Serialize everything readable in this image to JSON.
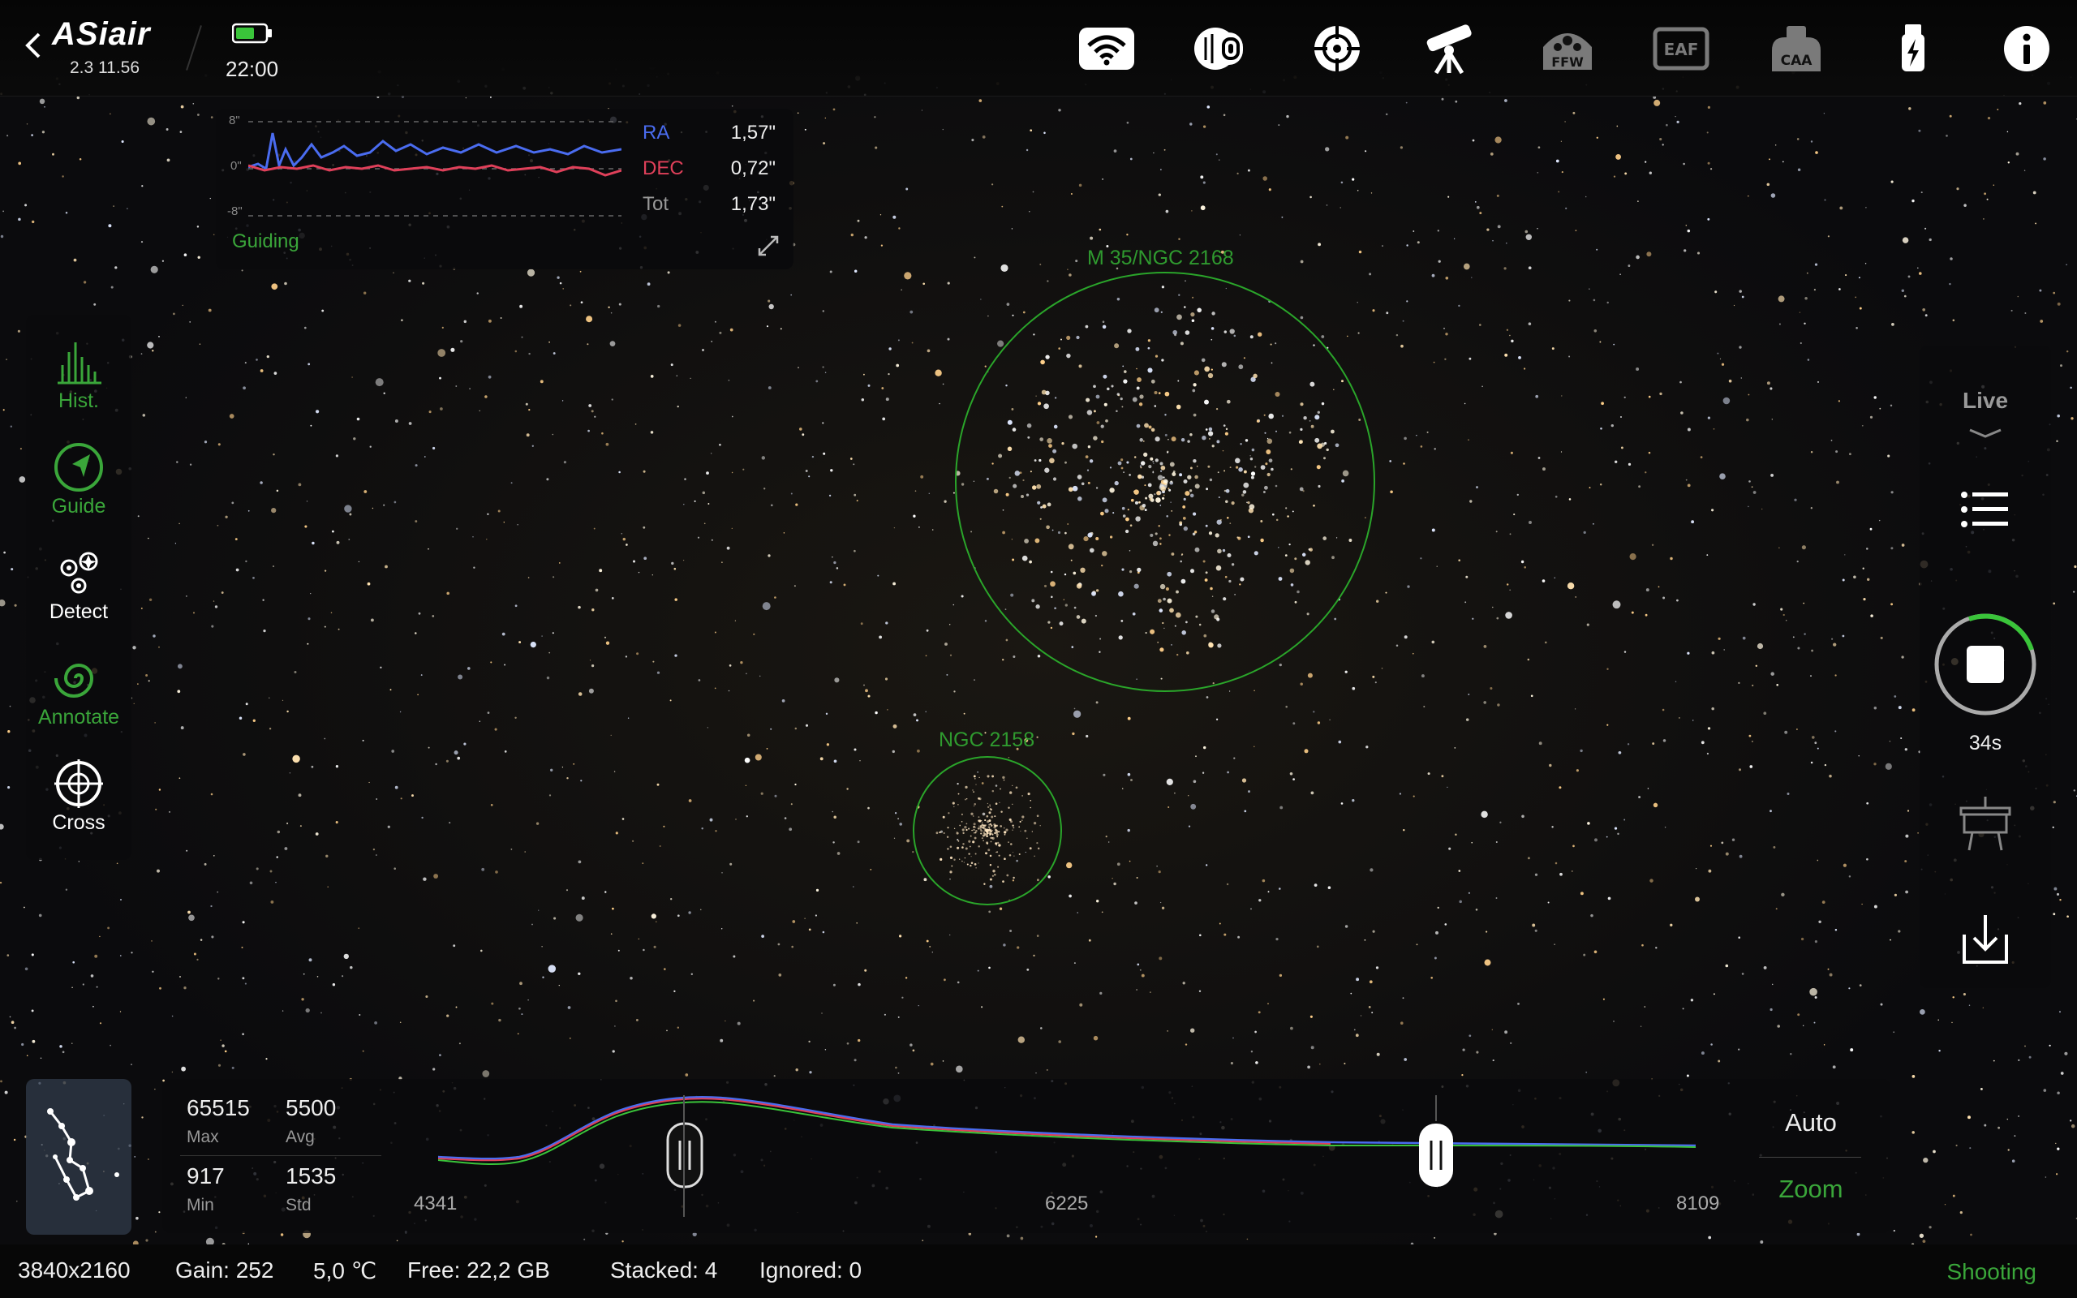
{
  "app": {
    "name": "ASiair",
    "version": "2.3 11.56",
    "time": "22:00"
  },
  "top_icons": [
    {
      "name": "wifi-icon"
    },
    {
      "name": "camera-icon"
    },
    {
      "name": "guide-scope-icon"
    },
    {
      "name": "telescope-mount-icon"
    },
    {
      "name": "filter-wheel-icon",
      "label": "FFW"
    },
    {
      "name": "focuser-icon",
      "label": "EAF"
    },
    {
      "name": "caa-icon",
      "label": "CAA"
    },
    {
      "name": "usb-power-icon"
    },
    {
      "name": "info-icon"
    }
  ],
  "guiding": {
    "label": "Guiding",
    "scale_top": "8\"",
    "scale_mid": "0\"",
    "scale_bottom": "-8\"",
    "rows": [
      {
        "name": "RA",
        "value": "1,57\"",
        "color": "#4a6cf0"
      },
      {
        "name": "DEC",
        "value": "0,72\"",
        "color": "#e0405a"
      },
      {
        "name": "Tot",
        "value": "1,73\"",
        "color": "#999999"
      }
    ]
  },
  "left_tools": [
    {
      "label": "Hist.",
      "color": "#3aa63a",
      "icon": "histogram-icon"
    },
    {
      "label": "Guide",
      "color": "#3aa63a",
      "icon": "guide-compass-icon"
    },
    {
      "label": "Detect",
      "color": "#ffffff",
      "icon": "detect-stars-icon"
    },
    {
      "label": "Annotate",
      "color": "#3aa63a",
      "icon": "annotate-galaxy-icon"
    },
    {
      "label": "Cross",
      "color": "#ffffff",
      "icon": "crosshair-icon"
    }
  ],
  "right_panel": {
    "mode": "Live",
    "timer": "34s"
  },
  "objects": [
    {
      "label": "M 35/NGC 2168"
    },
    {
      "label": "NGC 2158"
    }
  ],
  "histogram": {
    "max": "65515",
    "max_label": "Max",
    "avg": "5500",
    "avg_label": "Avg",
    "min": "917",
    "min_label": "Min",
    "std": "1535",
    "std_label": "Std",
    "axis_left": "4341",
    "axis_mid": "6225",
    "axis_right": "8109",
    "auto_label": "Auto",
    "zoom_label": "Zoom"
  },
  "status": {
    "resolution": "3840x2160",
    "gain": "Gain: 252",
    "temp": "5,0 ℃",
    "free": "Free: 22,2 GB",
    "stacked": "Stacked: 4",
    "ignored": "Ignored: 0",
    "state": "Shooting"
  },
  "colors": {
    "accent_green": "#3aa63a",
    "ra_blue": "#4a6cf0",
    "dec_red": "#e0405a"
  }
}
